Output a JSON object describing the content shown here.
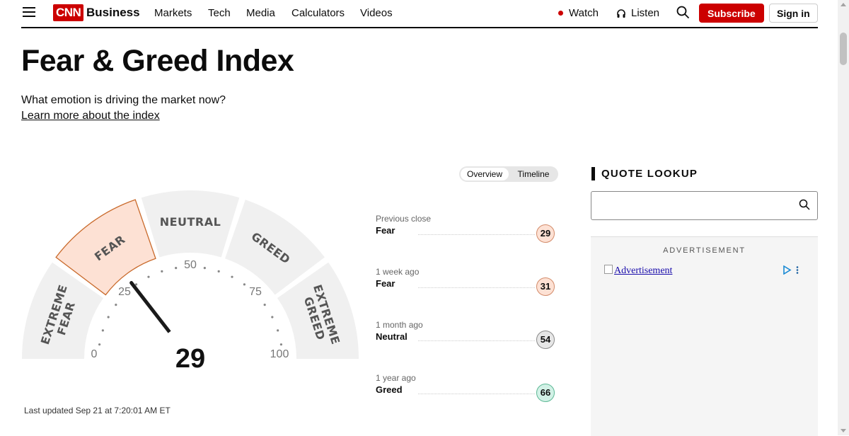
{
  "nav": {
    "logo": "CNN",
    "section": "Business",
    "links": [
      "Markets",
      "Tech",
      "Media",
      "Calculators",
      "Videos"
    ],
    "watch": "Watch",
    "listen": "Listen",
    "subscribe": "Subscribe",
    "sign_in": "Sign in"
  },
  "page": {
    "title": "Fear & Greed Index",
    "subtitle": "What emotion is driving the market now?",
    "learn_more": "Learn more about the index"
  },
  "view_toggle": {
    "options": [
      "Overview",
      "Timeline"
    ],
    "selected": "Overview"
  },
  "gauge": {
    "score": "29",
    "score_value": 29,
    "current_band": "FEAR",
    "bands": [
      {
        "lines": [
          "EXTREME",
          "FEAR"
        ]
      },
      {
        "lines": [
          "FEAR"
        ]
      },
      {
        "lines": [
          "NEUTRAL"
        ]
      },
      {
        "lines": [
          "GREED"
        ]
      },
      {
        "lines": [
          "EXTREME",
          "GREED"
        ]
      }
    ],
    "ticks": [
      "0",
      "25",
      "50",
      "75",
      "100"
    ],
    "colors": {
      "band_bg": "#f0f0f0",
      "active_fill": "#fde1d4",
      "active_stroke": "#c96a2b",
      "needle": "#1a1a1a"
    },
    "last_updated": "Last updated Sep 21 at 7:20:01 AM ET"
  },
  "history": [
    {
      "label": "Previous close",
      "rating": "Fear",
      "value": "29",
      "color": "#fde1d4",
      "border": "#d38b6a"
    },
    {
      "label": "1 week ago",
      "rating": "Fear",
      "value": "31",
      "color": "#fde1d4",
      "border": "#d38b6a"
    },
    {
      "label": "1 month ago",
      "rating": "Neutral",
      "value": "54",
      "color": "#e6e6e6",
      "border": "#8a8a8a"
    },
    {
      "label": "1 year ago",
      "rating": "Greed",
      "value": "66",
      "color": "#d2f1e6",
      "border": "#5db895"
    }
  ],
  "quote_lookup": {
    "heading": "QUOTE LOOKUP",
    "value": "",
    "placeholder": ""
  },
  "ad": {
    "label": "ADVERTISEMENT",
    "alt_text": "Advertisement"
  },
  "icons": {
    "menu": "hamburger-menu-icon",
    "live": "live-dot-icon",
    "listen": "headphones-icon",
    "search": "search-icon",
    "adchoices": "adchoices-icon"
  },
  "colors": {
    "brand_red": "#cc0000",
    "text": "#0c0c0c"
  }
}
